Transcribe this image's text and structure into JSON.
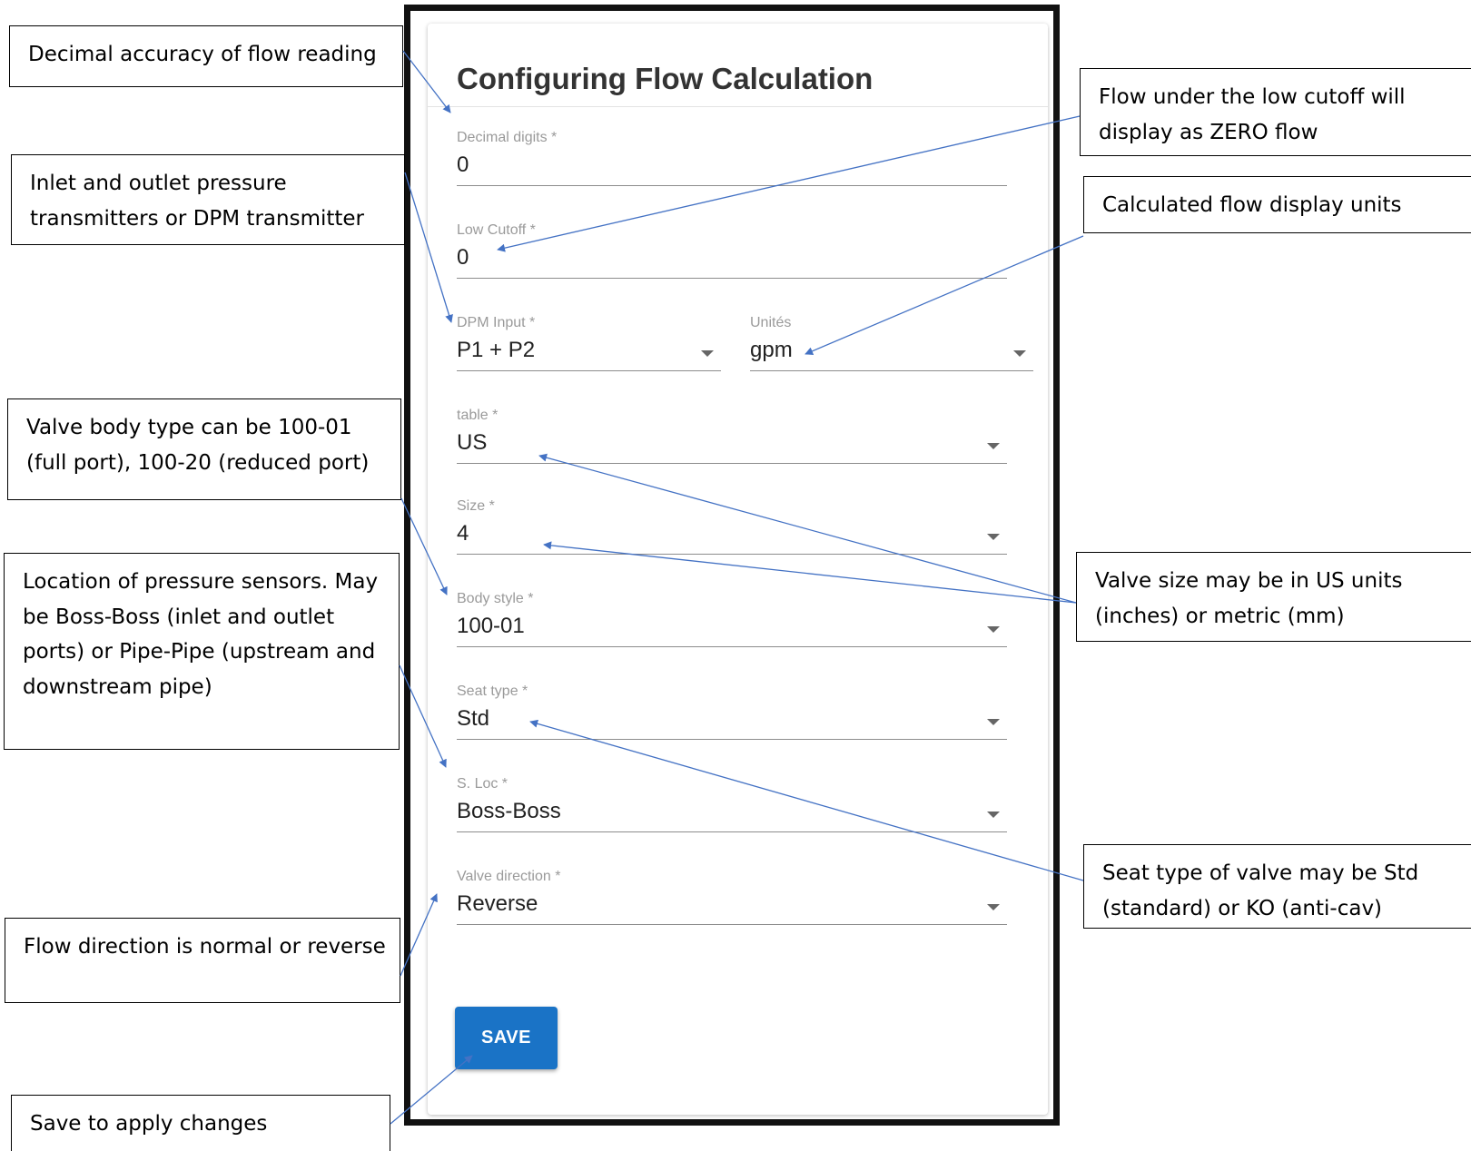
{
  "form": {
    "title": "Configuring Flow Calculation",
    "fields": {
      "decimal_digits": {
        "label": "Decimal digits *",
        "value": "0"
      },
      "low_cutoff": {
        "label": "Low Cutoff *",
        "value": "0"
      },
      "dpm_input": {
        "label": "DPM Input *",
        "value": "P1 + P2"
      },
      "units": {
        "label": "Unités",
        "value": "gpm"
      },
      "table": {
        "label": "table *",
        "value": "US"
      },
      "size": {
        "label": "Size *",
        "value": "4"
      },
      "body_style": {
        "label": "Body style *",
        "value": "100-01"
      },
      "seat_type": {
        "label": "Seat type *",
        "value": "Std"
      },
      "s_loc": {
        "label": "S. Loc *",
        "value": "Boss-Boss"
      },
      "valve_direction": {
        "label": "Valve direction *",
        "value": "Reverse"
      }
    },
    "save_label": "SAVE"
  },
  "callouts": {
    "decimal": "Decimal accuracy of flow reading",
    "inlet": "Inlet and outlet pressure transmitters or DPM transmitter",
    "body": "Valve body type can be 100-01 (full port), 100-20 (reduced port)",
    "location": "Location of pressure sensors. May be Boss-Boss (inlet and outlet ports) or Pipe-Pipe (upstream and downstream pipe)",
    "direction": "Flow direction is normal or reverse",
    "save": "Save to apply changes",
    "low_cutoff": "Flow under the low cutoff will display as ZERO flow",
    "units": "Calculated flow display units",
    "size": "Valve size may be in US units (inches) or metric (mm)",
    "seat": "Seat type of valve may be Std (standard) or KO (anti-cav)"
  },
  "colors": {
    "arrow": "#4472c4",
    "save_button": "#1a73c6",
    "frame_border": "#111111"
  }
}
